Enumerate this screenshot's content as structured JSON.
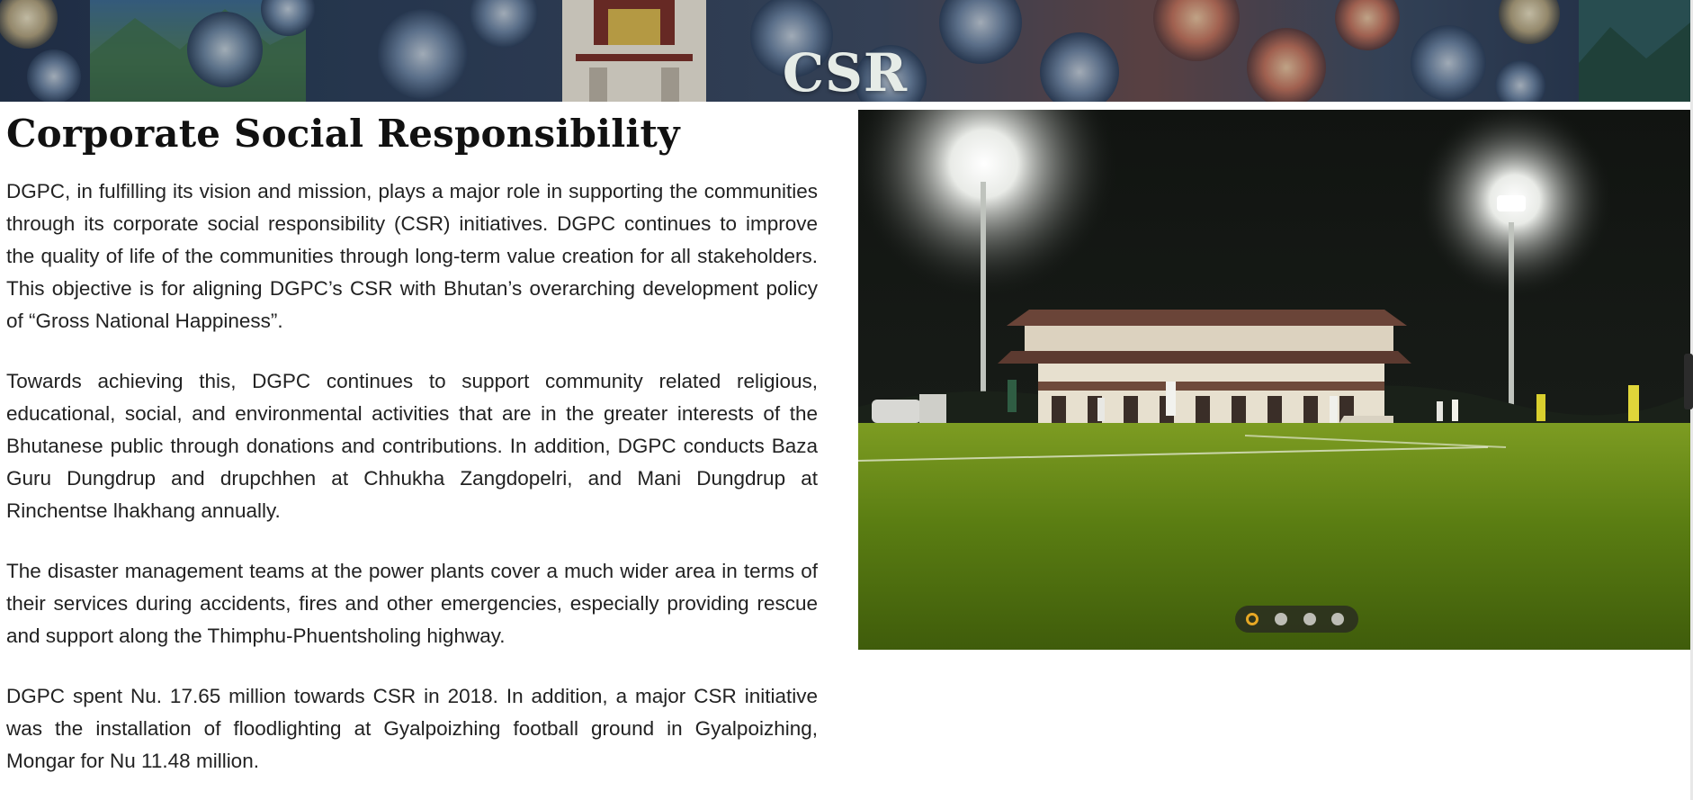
{
  "banner": {
    "title": "CSR"
  },
  "main": {
    "heading": "Corporate Social Responsibility",
    "paragraphs": [
      "DGPC, in fulfilling its vision and mission, plays a major role in supporting the communities through its corporate social responsibility (CSR) initiatives. DGPC continues to improve the quality of life of the communities through long-term value creation for all stakeholders. This objective is for aligning DGPC’s CSR with Bhutan’s overarching development policy of “Gross National Happiness”.",
      "Towards achieving this, DGPC continues to support community related religious, educational, social, and environmental activities that are in the greater interests of the Bhutanese public through donations and contributions. In addition, DGPC conducts Baza Guru Dungdrup and drupchhen at Chhukha Zangdopelri, and Mani Dungdrup at Rinchentse lhakhang annually.",
      "The disaster management teams at the power plants cover a much wider area in terms of their services during accidents, fires and other emergencies, especially providing rescue and support along the Thimphu-Phuentsholing highway.",
      "DGPC spent Nu. 17.65 million towards CSR in 2018. In addition, a major CSR initiative was the installation of floodlighting at Gyalpoizhing football ground in Gyalpoizhing, Mongar for Nu 11.48 million."
    ]
  },
  "slideshow": {
    "slide_count": 4,
    "active_index": 0,
    "colors": {
      "active_dot": "#e7a825",
      "idle_dot": "#bdbdb5",
      "pitch": "#5a7d12",
      "night_sky": "#0d0f0c"
    }
  }
}
